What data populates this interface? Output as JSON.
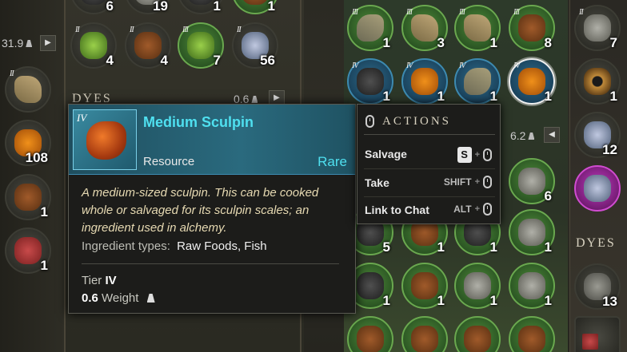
{
  "left_column": {
    "weight": "31.9",
    "slots": [
      {
        "tier": "II",
        "qty": ""
      },
      {
        "tier": "",
        "qty": "108"
      },
      {
        "tier": "",
        "qty": "1"
      },
      {
        "tier": "",
        "qty": "1"
      }
    ]
  },
  "middle_inventory": {
    "top_slots": [
      {
        "tier": "",
        "qty": "6"
      },
      {
        "tier": "",
        "qty": "19"
      },
      {
        "tier": "",
        "qty": "1"
      },
      {
        "tier": "",
        "qty": "1"
      }
    ],
    "row2_slots": [
      {
        "tier": "II",
        "qty": "4"
      },
      {
        "tier": "II",
        "qty": "4"
      },
      {
        "tier": "III",
        "qty": "7"
      },
      {
        "tier": "II",
        "qty": "56"
      }
    ],
    "dyes_label": "DYES",
    "dyes_weight": "0.6"
  },
  "right_inventory": {
    "weight": "6.2",
    "row1": [
      {
        "tier": "III",
        "qty": "1"
      },
      {
        "tier": "III",
        "qty": "3"
      },
      {
        "tier": "III",
        "qty": "1"
      },
      {
        "tier": "III",
        "qty": "8"
      }
    ],
    "row2": [
      {
        "tier": "IV",
        "qty": "1"
      },
      {
        "tier": "IV",
        "qty": "1"
      },
      {
        "tier": "IV",
        "qty": "1"
      },
      {
        "tier": "IV",
        "qty": "1"
      }
    ],
    "row3": [
      {
        "qty": "6"
      }
    ],
    "row4": [
      {
        "qty": "5"
      },
      {
        "qty": "1"
      },
      {
        "qty": "1"
      },
      {
        "qty": "1"
      }
    ],
    "row5": [
      {
        "qty": "1"
      },
      {
        "qty": "1"
      },
      {
        "qty": "1"
      },
      {
        "qty": "1"
      }
    ]
  },
  "far_right_column": {
    "slots": [
      {
        "tier": "II",
        "qty": "7"
      },
      {
        "tier": "",
        "qty": "1"
      },
      {
        "tier": "",
        "qty": "12"
      },
      {
        "tier": "",
        "qty": ""
      }
    ],
    "dyes_label": "DYES",
    "mortar_qty": "13"
  },
  "tooltip": {
    "tier": "IV",
    "name": "Medium Sculpin",
    "type": "Resource",
    "rarity": "Rare",
    "description": "A medium-sized sculpin. This can be cooked whole or salvaged for its sculpin scales; an ingredient used in alchemy.",
    "ingredient_label": "Ingredient types:",
    "ingredient_value": "Raw Foods, Fish",
    "tier_label": "Tier",
    "tier_value": "IV",
    "weight_value": "0.6",
    "weight_label": "Weight"
  },
  "actions": {
    "title": "ACTIONS",
    "items": [
      {
        "label": "Salvage",
        "key": "S"
      },
      {
        "label": "Take",
        "key": "SHIFT"
      },
      {
        "label": "Link to Chat",
        "key": "ALT"
      }
    ]
  },
  "colors": {
    "rare": "#4fe0f0",
    "description": "#e6d9b2"
  }
}
